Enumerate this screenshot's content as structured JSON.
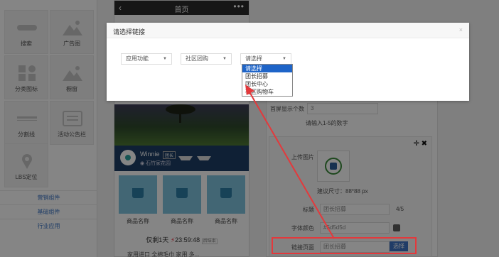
{
  "library": {
    "tiles": [
      {
        "label": "搜索",
        "icon": "search-bar-icon"
      },
      {
        "label": "广告图",
        "icon": "image-icon"
      },
      {
        "label": "分类图标",
        "icon": "category-icon"
      },
      {
        "label": "橱窗",
        "icon": "showcase-icon"
      },
      {
        "label": "分割线",
        "icon": "divider-icon"
      },
      {
        "label": "活动公告栏",
        "icon": "notice-board-icon"
      },
      {
        "label": "LBS定位",
        "icon": "location-pin-icon"
      }
    ],
    "groups": [
      "营销组件",
      "基础组件",
      "行业应用"
    ]
  },
  "phone": {
    "title": "首页",
    "back_icon": "chevron-left-icon",
    "more_icon": "more-dots-icon",
    "shop_name": "Winnie",
    "shop_badge": "团长",
    "shop_address": "石竹家花园",
    "goods": [
      "商品名称",
      "商品名称",
      "商品名称"
    ],
    "countdown_prefix": "仅剩1天",
    "countdown_time": "23:59:48",
    "countdown_suffix": "后结束",
    "truncated_text": "家用进口 全棉毛巾 家用 多..."
  },
  "editor": {
    "count_label": "首屏显示个数",
    "count_value": "3",
    "count_hint": "请输入1-5的数字",
    "upload_label": "上传图片",
    "size_hint": "建议尺寸：88*88 px",
    "title_label": "标题",
    "title_value": "团长招募",
    "title_counter": "4/5",
    "font_color_label": "字体颜色",
    "font_color_value": "#5d5d5d",
    "link_label": "链接页面",
    "link_value": "团长招募",
    "choose_button": "选择"
  },
  "modal": {
    "title": "请选择链接",
    "close_icon": "close-icon",
    "select1": "应用功能",
    "select2": "社区团购",
    "select3": "请选择",
    "options": [
      "请选择",
      "团长招募",
      "团长中心",
      "社区购物车"
    ],
    "selected_index": 0
  },
  "colors": {
    "accent_blue": "#1e64c8",
    "button_blue": "#3e74c6",
    "highlight_red": "#e3393c",
    "overlay": "rgba(0,0,0,0.48)"
  }
}
